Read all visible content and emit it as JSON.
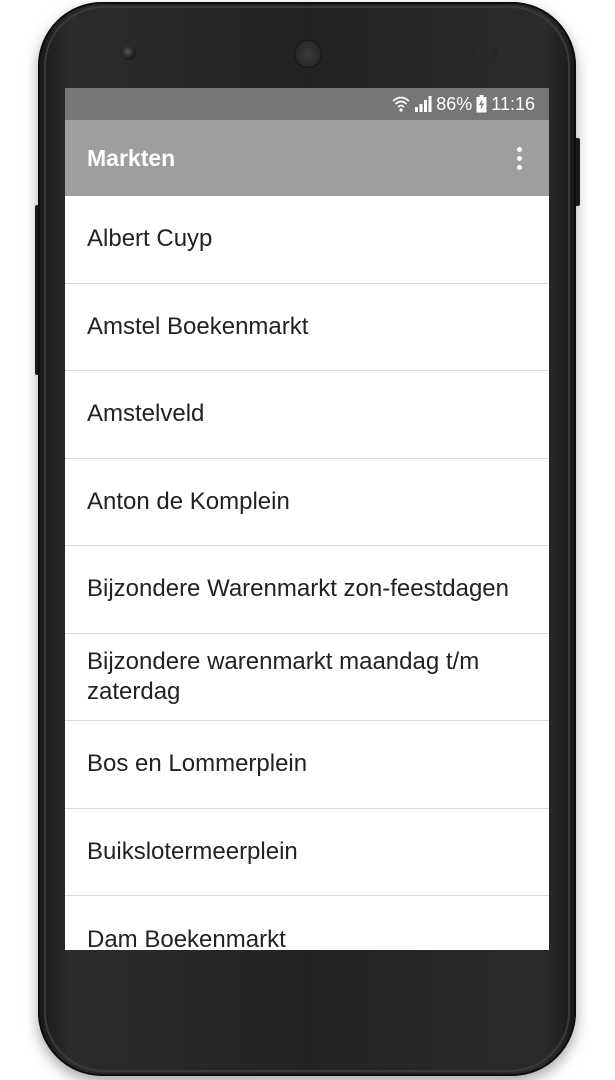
{
  "status_bar": {
    "battery": "86%",
    "time": "11:16",
    "wifi_icon": "wifi-icon",
    "signal_icon": "signal-icon",
    "battery_icon": "battery-charging-icon"
  },
  "app_bar": {
    "title": "Markten",
    "menu_icon": "more-vert-icon"
  },
  "markets": [
    "Albert Cuyp",
    "Amstel Boekenmarkt",
    "Amstelveld",
    "Anton de Komplein",
    "Bijzondere Warenmarkt zon-feestdagen",
    "Bijzondere warenmarkt maandag t/m zaterdag",
    "Bos en Lommerplein",
    "Buikslotermeerplein",
    "Dam Boekenmarkt"
  ],
  "colors": {
    "status_bar": "#767676",
    "app_bar": "#9e9e9e",
    "list_text": "#222222",
    "divider": "#dcdcdc"
  }
}
